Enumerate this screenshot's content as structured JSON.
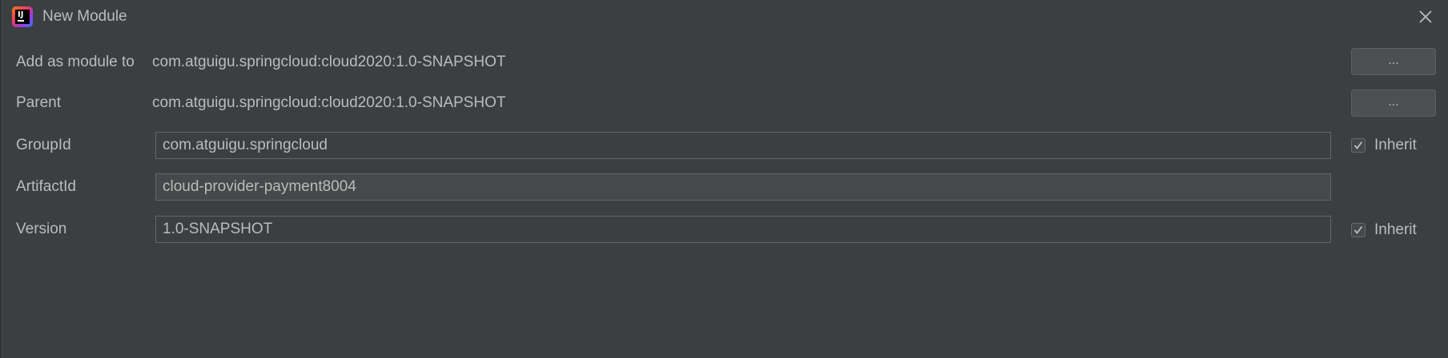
{
  "window": {
    "title": "New Module",
    "app_icon": "intellij-idea-icon",
    "close_icon": "close-icon"
  },
  "form": {
    "add_as_module_to": {
      "label": "Add as module to",
      "value": "com.atguigu.springcloud:cloud2020:1.0-SNAPSHOT",
      "button_label": "..."
    },
    "parent": {
      "label": "Parent",
      "value": "com.atguigu.springcloud:cloud2020:1.0-SNAPSHOT",
      "button_label": "..."
    },
    "group_id": {
      "label": "GroupId",
      "value": "com.atguigu.springcloud",
      "inherit_label": "Inherit",
      "inherit_checked": true
    },
    "artifact_id": {
      "label": "ArtifactId",
      "value": "cloud-provider-payment8004"
    },
    "version": {
      "label": "Version",
      "value": "1.0-SNAPSHOT",
      "inherit_label": "Inherit",
      "inherit_checked": true
    }
  }
}
